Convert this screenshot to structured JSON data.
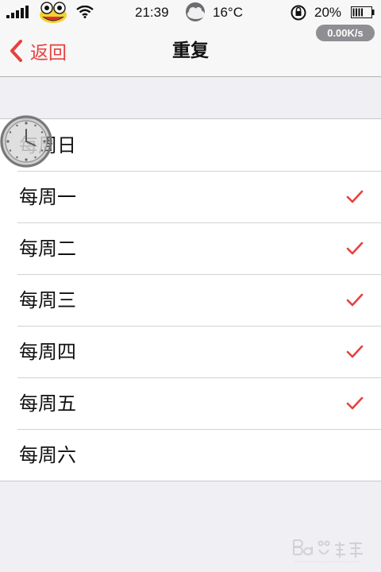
{
  "status_bar": {
    "time": "21:39",
    "temperature": "16°C",
    "battery_percent": "20%",
    "network_speed": "0.00K/s",
    "icons": [
      "signal-bars-icon",
      "mascot-frog-icon",
      "wifi-icon",
      "weather-cloud-icon",
      "rotation-lock-icon",
      "battery-icon"
    ]
  },
  "nav": {
    "back_label": "返回",
    "title": "重复"
  },
  "days": [
    {
      "label": "每周日",
      "checked": false
    },
    {
      "label": "每周一",
      "checked": true
    },
    {
      "label": "每周二",
      "checked": true
    },
    {
      "label": "每周三",
      "checked": true
    },
    {
      "label": "每周四",
      "checked": true
    },
    {
      "label": "每周五",
      "checked": true
    },
    {
      "label": "每周六",
      "checked": false
    }
  ],
  "colors": {
    "accent": "#e8413e",
    "background": "#efeff4"
  }
}
